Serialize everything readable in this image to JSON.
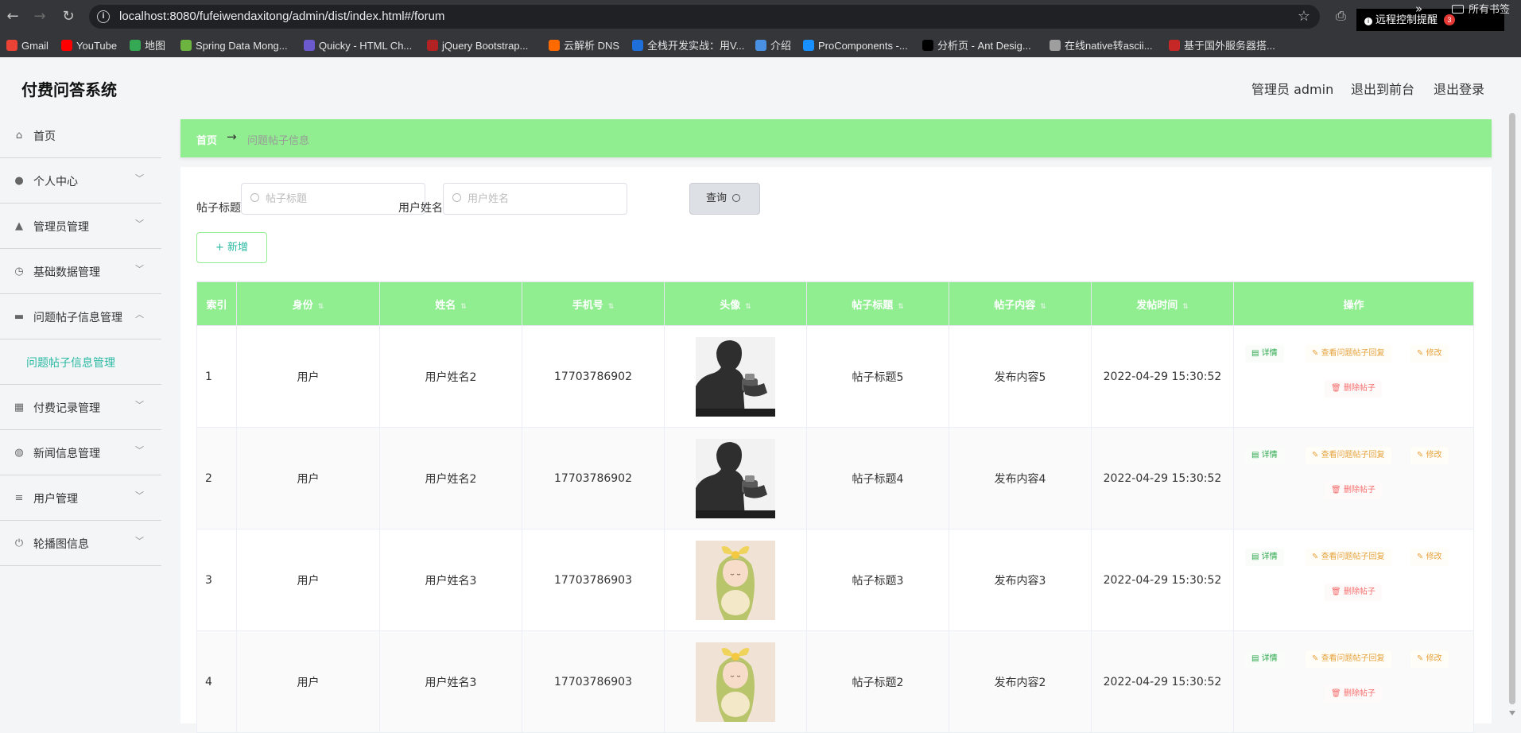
{
  "browser": {
    "url": "localhost:8080/fufeiwendaxitong/admin/dist/index.html#/forum",
    "remote_control": "远程控制提醒",
    "notification_count": "3",
    "bookmarks": [
      {
        "label": "Gmail",
        "color": "#ea4335"
      },
      {
        "label": "YouTube",
        "color": "#ff0000"
      },
      {
        "label": "地图",
        "color": "#34a853"
      },
      {
        "label": "Spring Data Mong...",
        "color": "#6db33f"
      },
      {
        "label": "Quicky - HTML Ch...",
        "color": "#6a5acd"
      },
      {
        "label": "jQuery Bootstrap...",
        "color": "#b22222"
      },
      {
        "label": "云解析 DNS",
        "color": "#ff6a00"
      },
      {
        "label": "全栈开发实战：用V...",
        "color": "#1e6fd9"
      },
      {
        "label": "介绍",
        "color": "#4a90e2"
      },
      {
        "label": "ProComponents -...",
        "color": "#1890ff"
      },
      {
        "label": "分析页 - Ant Desig...",
        "color": "#000000"
      },
      {
        "label": "在线native转ascii...",
        "color": "#9e9e9e"
      },
      {
        "label": "基于国外服务器搭...",
        "color": "#c62828"
      }
    ],
    "all_bookmarks": "所有书签"
  },
  "app": {
    "title": "付费问答系统",
    "admin": "管理员 admin",
    "to_frontend": "退出到前台",
    "logout": "退出登录"
  },
  "sidebar": {
    "items": [
      {
        "label": "首页",
        "icon": "home-icon"
      },
      {
        "label": "个人中心",
        "icon": "user-icon"
      },
      {
        "label": "管理员管理",
        "icon": "admin-icon"
      },
      {
        "label": "基础数据管理",
        "icon": "clock-icon"
      },
      {
        "label": "问题帖子信息管理",
        "icon": "ticket-icon"
      },
      {
        "label": "付费记录管理",
        "icon": "grid-icon"
      },
      {
        "label": "新闻信息管理",
        "icon": "globe-icon"
      },
      {
        "label": "用户管理",
        "icon": "list-icon"
      },
      {
        "label": "轮播图信息",
        "icon": "power-icon"
      }
    ],
    "submenu_label": "问题帖子信息管理"
  },
  "breadcrumb": {
    "home": "首页",
    "separator": "→",
    "current": "问题帖子信息"
  },
  "filters": {
    "title_label": "帖子标题",
    "title_placeholder": "帖子标题",
    "user_label": "用户姓名",
    "user_placeholder": "用户姓名",
    "query": "查询",
    "add": "+ 新增"
  },
  "table": {
    "headers": [
      "索引",
      "身份",
      "姓名",
      "手机号",
      "头像",
      "帖子标题",
      "帖子内容",
      "发帖时间",
      "操作"
    ],
    "rows": [
      {
        "index": "1",
        "role": "用户",
        "name": "用户姓名2",
        "phone": "17703786902",
        "avatar": "man",
        "title": "帖子标题5",
        "content": "发布内容5",
        "time": "2022-04-29 15:30:52"
      },
      {
        "index": "2",
        "role": "用户",
        "name": "用户姓名2",
        "phone": "17703786902",
        "avatar": "man",
        "title": "帖子标题4",
        "content": "发布内容4",
        "time": "2022-04-29 15:30:52"
      },
      {
        "index": "3",
        "role": "用户",
        "name": "用户姓名3",
        "phone": "17703786903",
        "avatar": "girl",
        "title": "帖子标题3",
        "content": "发布内容3",
        "time": "2022-04-29 15:30:52"
      },
      {
        "index": "4",
        "role": "用户",
        "name": "用户姓名3",
        "phone": "17703786903",
        "avatar": "girl",
        "title": "帖子标题2",
        "content": "发布内容2",
        "time": "2022-04-29 15:30:52"
      }
    ],
    "actions": {
      "detail": "详情",
      "view_replies": "查看问题帖子回复",
      "edit": "修改",
      "delete": "删除帖子"
    }
  },
  "colors": {
    "accent_green": "#90ee90",
    "teal": "#2bb9a3",
    "warning": "#e6a23c",
    "danger": "#f56c6c"
  }
}
